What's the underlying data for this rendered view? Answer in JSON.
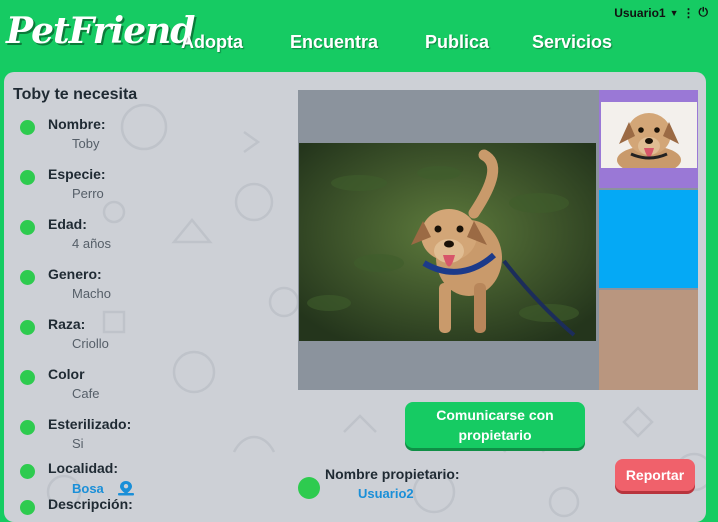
{
  "header": {
    "logo": "PetFriend",
    "nav": [
      "Adopta",
      "Encuentra",
      "Publica",
      "Servicios"
    ],
    "user": "Usuario1"
  },
  "pet": {
    "title": "Toby te necesita",
    "fields": [
      {
        "label": "Nombre:",
        "value": "Toby"
      },
      {
        "label": "Especie:",
        "value": "Perro"
      },
      {
        "label": "Edad:",
        "value": "4 años"
      },
      {
        "label": "Genero:",
        "value": "Macho"
      },
      {
        "label": "Raza:",
        "value": "Criollo"
      },
      {
        "label": "Color",
        "value": "Cafe"
      },
      {
        "label": "Esterilizado:",
        "value": "Si"
      },
      {
        "label": "Localidad:",
        "value": "Bosa"
      },
      {
        "label": "Descripción:",
        "value": ""
      }
    ]
  },
  "actions": {
    "contact": "Comunicarse con propietario",
    "report": "Reportar"
  },
  "owner": {
    "label": "Nombre propietario:",
    "name": "Usuario2"
  },
  "colors": {
    "brand_green": "#16cb63",
    "thumb_purple": "#9a78d6",
    "thumb_blue": "#05a9f5",
    "thumb_tan": "#b9967f",
    "report_red": "#f0616b"
  },
  "icons": [
    "caret-down-icon",
    "more-vert-icon",
    "power-icon",
    "map-pin-icon"
  ]
}
